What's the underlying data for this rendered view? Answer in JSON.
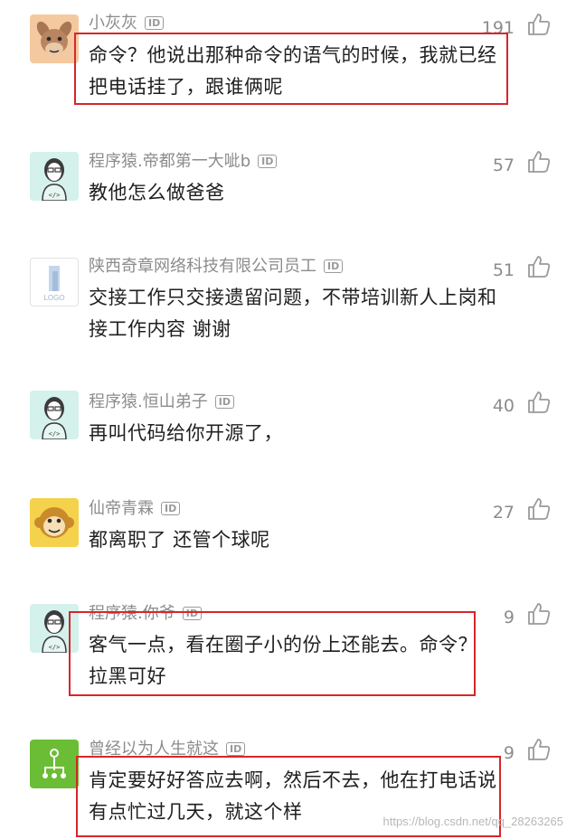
{
  "comments": [
    {
      "username": "小灰灰",
      "id_badge": "ID",
      "likes": "191",
      "text": "命令？他说出那种命令的语气的时候，我就已经把电话挂了，跟谁俩呢",
      "avatar": "donkey"
    },
    {
      "username": "程序猿.帝都第一大呲b",
      "id_badge": "ID",
      "likes": "57",
      "text": "教他怎么做爸爸",
      "avatar": "coder"
    },
    {
      "username": "陕西奇章网络科技有限公司员工",
      "id_badge": "ID",
      "likes": "51",
      "text": "交接工作只交接遗留问题，不带培训新人上岗和接工作内容 谢谢",
      "avatar": "logo",
      "avatar_text": "LOGO"
    },
    {
      "username": "程序猿.恒山弟子",
      "id_badge": "ID",
      "likes": "40",
      "text": "再叫代码给你开源了，",
      "avatar": "coder"
    },
    {
      "username": "仙帝青霖",
      "id_badge": "ID",
      "likes": "27",
      "text": "都离职了 还管个球呢",
      "avatar": "monkey"
    },
    {
      "username": "程序猿.你爷",
      "id_badge": "ID",
      "likes": "9",
      "text": "客气一点，看在圈子小的份上还能去。命令？拉黑可好",
      "avatar": "coder"
    },
    {
      "username": "曾经以为人生就这",
      "id_badge": "ID",
      "likes": "9",
      "text": "肯定要好好答应去啊，然后不去，他在打电话说有点忙过几天，就这个样",
      "avatar": "tree"
    }
  ],
  "watermark": "https://blog.csdn.net/qq_28263265",
  "colors": {
    "highlight": "#d6262a",
    "username": "#8c8c8c",
    "text": "#1f1f1f",
    "coder_avatar_bg": "#d4f1ec",
    "tree_avatar_bg": "#6bbd36",
    "monkey_avatar_bg": "#f5d24b",
    "donkey_avatar_bg": "#f5c9a0"
  }
}
